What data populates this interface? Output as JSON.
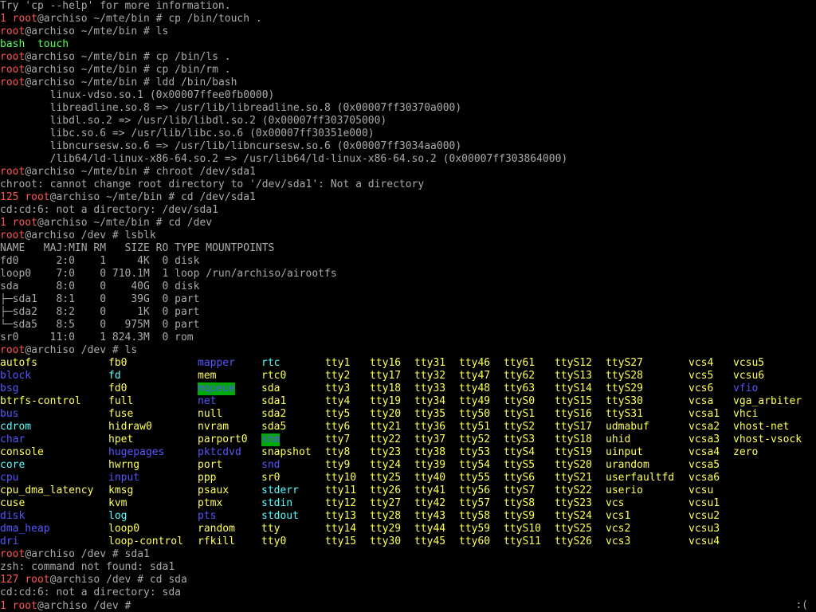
{
  "theme": {
    "background": "#000000",
    "default": "#aaaaaa",
    "red": "#ff5555",
    "green": "#55ff55",
    "yellow": "#ffff55",
    "blue": "#5555ff",
    "cyan": "#55ffff",
    "highlight_bg": "#00aa00"
  },
  "terminal": {
    "lines": [
      [
        {
          "t": "Try 'cp --help' for more information.",
          "c": "default"
        }
      ],
      [
        {
          "t": "1 ",
          "c": "red"
        },
        {
          "t": "root",
          "c": "red"
        },
        {
          "t": "@archiso ~/mte/bin # cp /bin/touch .",
          "c": "default"
        }
      ],
      [
        {
          "t": "root",
          "c": "red"
        },
        {
          "t": "@archiso ~/mte/bin # ls",
          "c": "default"
        }
      ],
      [
        {
          "t": "bash  touch",
          "c": "green"
        }
      ],
      [
        {
          "t": "root",
          "c": "red"
        },
        {
          "t": "@archiso ~/mte/bin # cp /bin/ls .",
          "c": "default"
        }
      ],
      [
        {
          "t": "root",
          "c": "red"
        },
        {
          "t": "@archiso ~/mte/bin # cp /bin/rm .",
          "c": "default"
        }
      ],
      [
        {
          "t": "root",
          "c": "red"
        },
        {
          "t": "@archiso ~/mte/bin # ldd /bin/bash",
          "c": "default"
        }
      ],
      [
        {
          "t": "        linux-vdso.so.1 (0x00007ffee0fb0000)",
          "c": "default"
        }
      ],
      [
        {
          "t": "        libreadline.so.8 => /usr/lib/libreadline.so.8 (0x00007ff30370a000)",
          "c": "default"
        }
      ],
      [
        {
          "t": "        libdl.so.2 => /usr/lib/libdl.so.2 (0x00007ff303705000)",
          "c": "default"
        }
      ],
      [
        {
          "t": "        libc.so.6 => /usr/lib/libc.so.6 (0x00007ff30351e000)",
          "c": "default"
        }
      ],
      [
        {
          "t": "        libncursesw.so.6 => /usr/lib/libncursesw.so.6 (0x00007ff3034aa000)",
          "c": "default"
        }
      ],
      [
        {
          "t": "        /lib64/ld-linux-x86-64.so.2 => /usr/lib64/ld-linux-x86-64.so.2 (0x00007ff303864000)",
          "c": "default"
        }
      ],
      [
        {
          "t": "root",
          "c": "red"
        },
        {
          "t": "@archiso ~/mte/bin # chroot /dev/sda1",
          "c": "default"
        }
      ],
      [
        {
          "t": "chroot: cannot change root directory to '/dev/sda1': Not a directory",
          "c": "default"
        }
      ],
      [
        {
          "t": "125 ",
          "c": "red"
        },
        {
          "t": "root",
          "c": "red"
        },
        {
          "t": "@archiso ~/mte/bin # cd /dev/sda1",
          "c": "default"
        }
      ],
      [
        {
          "t": "cd:cd:6: not a directory: /dev/sda1",
          "c": "default"
        }
      ],
      [
        {
          "t": "1 ",
          "c": "red"
        },
        {
          "t": "root",
          "c": "red"
        },
        {
          "t": "@archiso ~/mte/bin # cd /dev",
          "c": "default"
        }
      ],
      [
        {
          "t": "root",
          "c": "red"
        },
        {
          "t": "@archiso /dev # lsblk",
          "c": "default"
        }
      ],
      [
        {
          "t": "NAME   MAJ:MIN RM   SIZE RO TYPE MOUNTPOINTS",
          "c": "default"
        }
      ],
      [
        {
          "t": "fd0      2:0    1     4K  0 disk",
          "c": "default"
        }
      ],
      [
        {
          "t": "loop0    7:0    0 710.1M  1 loop /run/archiso/airootfs",
          "c": "default"
        }
      ],
      [
        {
          "t": "sda      8:0    0    40G  0 disk",
          "c": "default"
        }
      ],
      [
        {
          "t": "├─sda1   8:1    0    39G  0 part",
          "c": "default"
        }
      ],
      [
        {
          "t": "├─sda2   8:2    0     1K  0 part",
          "c": "default"
        }
      ],
      [
        {
          "t": "└─sda5   8:5    0   975M  0 part",
          "c": "default"
        }
      ],
      [
        {
          "t": "sr0     11:0    1 824.3M  0 rom",
          "c": "default"
        }
      ],
      [
        {
          "t": "root",
          "c": "red"
        },
        {
          "t": "@archiso /dev # ls",
          "c": "default"
        }
      ]
    ],
    "listing": {
      "columns": [
        0,
        136,
        248,
        328,
        408,
        464,
        520,
        576,
        632,
        696,
        760,
        864,
        920
      ],
      "rows": [
        [
          [
            "autofs",
            "yellow"
          ],
          [
            "fb0",
            "yellow"
          ],
          [
            "mapper",
            "blue"
          ],
          [
            "rtc",
            "cyan"
          ],
          [
            "tty1",
            "yellow"
          ],
          [
            "tty16",
            "yellow"
          ],
          [
            "tty31",
            "yellow"
          ],
          [
            "tty46",
            "yellow"
          ],
          [
            "tty61",
            "yellow"
          ],
          [
            "ttyS12",
            "yellow"
          ],
          [
            "ttyS27",
            "yellow"
          ],
          [
            "vcs4",
            "yellow"
          ],
          [
            "vcsu5",
            "yellow"
          ]
        ],
        [
          [
            "block",
            "blue"
          ],
          [
            "fd",
            "cyan"
          ],
          [
            "mem",
            "yellow"
          ],
          [
            "rtc0",
            "yellow"
          ],
          [
            "tty2",
            "yellow"
          ],
          [
            "tty17",
            "yellow"
          ],
          [
            "tty32",
            "yellow"
          ],
          [
            "tty47",
            "yellow"
          ],
          [
            "tty62",
            "yellow"
          ],
          [
            "ttyS13",
            "yellow"
          ],
          [
            "ttyS28",
            "yellow"
          ],
          [
            "vcs5",
            "yellow"
          ],
          [
            "vcsu6",
            "yellow"
          ]
        ],
        [
          [
            "bsg",
            "blue"
          ],
          [
            "fd0",
            "yellow"
          ],
          [
            "mqueue",
            "hl"
          ],
          [
            "sda",
            "yellow"
          ],
          [
            "tty3",
            "yellow"
          ],
          [
            "tty18",
            "yellow"
          ],
          [
            "tty33",
            "yellow"
          ],
          [
            "tty48",
            "yellow"
          ],
          [
            "tty63",
            "yellow"
          ],
          [
            "ttyS14",
            "yellow"
          ],
          [
            "ttyS29",
            "yellow"
          ],
          [
            "vcs6",
            "yellow"
          ],
          [
            "vfio",
            "blue"
          ]
        ],
        [
          [
            "btrfs-control",
            "yellow"
          ],
          [
            "full",
            "yellow"
          ],
          [
            "net",
            "blue"
          ],
          [
            "sda1",
            "yellow"
          ],
          [
            "tty4",
            "yellow"
          ],
          [
            "tty19",
            "yellow"
          ],
          [
            "tty34",
            "yellow"
          ],
          [
            "tty49",
            "yellow"
          ],
          [
            "ttyS0",
            "yellow"
          ],
          [
            "ttyS15",
            "yellow"
          ],
          [
            "ttyS30",
            "yellow"
          ],
          [
            "vcsa",
            "yellow"
          ],
          [
            "vga_arbiter",
            "yellow"
          ]
        ],
        [
          [
            "bus",
            "blue"
          ],
          [
            "fuse",
            "yellow"
          ],
          [
            "null",
            "yellow"
          ],
          [
            "sda2",
            "yellow"
          ],
          [
            "tty5",
            "yellow"
          ],
          [
            "tty20",
            "yellow"
          ],
          [
            "tty35",
            "yellow"
          ],
          [
            "tty50",
            "yellow"
          ],
          [
            "ttyS1",
            "yellow"
          ],
          [
            "ttyS16",
            "yellow"
          ],
          [
            "ttyS31",
            "yellow"
          ],
          [
            "vcsa1",
            "yellow"
          ],
          [
            "vhci",
            "yellow"
          ]
        ],
        [
          [
            "cdrom",
            "cyan"
          ],
          [
            "hidraw0",
            "yellow"
          ],
          [
            "nvram",
            "yellow"
          ],
          [
            "sda5",
            "yellow"
          ],
          [
            "tty6",
            "yellow"
          ],
          [
            "tty21",
            "yellow"
          ],
          [
            "tty36",
            "yellow"
          ],
          [
            "tty51",
            "yellow"
          ],
          [
            "ttyS2",
            "yellow"
          ],
          [
            "ttyS17",
            "yellow"
          ],
          [
            "udmabuf",
            "yellow"
          ],
          [
            "vcsa2",
            "yellow"
          ],
          [
            "vhost-net",
            "yellow"
          ]
        ],
        [
          [
            "char",
            "blue"
          ],
          [
            "hpet",
            "yellow"
          ],
          [
            "parport0",
            "yellow"
          ],
          [
            "shm",
            "hl"
          ],
          [
            "tty7",
            "yellow"
          ],
          [
            "tty22",
            "yellow"
          ],
          [
            "tty37",
            "yellow"
          ],
          [
            "tty52",
            "yellow"
          ],
          [
            "ttyS3",
            "yellow"
          ],
          [
            "ttyS18",
            "yellow"
          ],
          [
            "uhid",
            "yellow"
          ],
          [
            "vcsa3",
            "yellow"
          ],
          [
            "vhost-vsock",
            "yellow"
          ]
        ],
        [
          [
            "console",
            "yellow"
          ],
          [
            "hugepages",
            "blue"
          ],
          [
            "pktcdvd",
            "blue"
          ],
          [
            "snapshot",
            "yellow"
          ],
          [
            "tty8",
            "yellow"
          ],
          [
            "tty23",
            "yellow"
          ],
          [
            "tty38",
            "yellow"
          ],
          [
            "tty53",
            "yellow"
          ],
          [
            "ttyS4",
            "yellow"
          ],
          [
            "ttyS19",
            "yellow"
          ],
          [
            "uinput",
            "yellow"
          ],
          [
            "vcsa4",
            "yellow"
          ],
          [
            "zero",
            "yellow"
          ]
        ],
        [
          [
            "core",
            "cyan"
          ],
          [
            "hwrng",
            "yellow"
          ],
          [
            "port",
            "yellow"
          ],
          [
            "snd",
            "blue"
          ],
          [
            "tty9",
            "yellow"
          ],
          [
            "tty24",
            "yellow"
          ],
          [
            "tty39",
            "yellow"
          ],
          [
            "tty54",
            "yellow"
          ],
          [
            "ttyS5",
            "yellow"
          ],
          [
            "ttyS20",
            "yellow"
          ],
          [
            "urandom",
            "yellow"
          ],
          [
            "vcsa5",
            "yellow"
          ]
        ],
        [
          [
            "cpu",
            "blue"
          ],
          [
            "input",
            "blue"
          ],
          [
            "ppp",
            "yellow"
          ],
          [
            "sr0",
            "yellow"
          ],
          [
            "tty10",
            "yellow"
          ],
          [
            "tty25",
            "yellow"
          ],
          [
            "tty40",
            "yellow"
          ],
          [
            "tty55",
            "yellow"
          ],
          [
            "ttyS6",
            "yellow"
          ],
          [
            "ttyS21",
            "yellow"
          ],
          [
            "userfaultfd",
            "yellow"
          ],
          [
            "vcsa6",
            "yellow"
          ]
        ],
        [
          [
            "cpu_dma_latency",
            "yellow"
          ],
          [
            "kmsg",
            "yellow"
          ],
          [
            "psaux",
            "yellow"
          ],
          [
            "stderr",
            "cyan"
          ],
          [
            "tty11",
            "yellow"
          ],
          [
            "tty26",
            "yellow"
          ],
          [
            "tty41",
            "yellow"
          ],
          [
            "tty56",
            "yellow"
          ],
          [
            "ttyS7",
            "yellow"
          ],
          [
            "ttyS22",
            "yellow"
          ],
          [
            "userio",
            "yellow"
          ],
          [
            "vcsu",
            "yellow"
          ]
        ],
        [
          [
            "cuse",
            "yellow"
          ],
          [
            "kvm",
            "yellow"
          ],
          [
            "ptmx",
            "yellow"
          ],
          [
            "stdin",
            "cyan"
          ],
          [
            "tty12",
            "yellow"
          ],
          [
            "tty27",
            "yellow"
          ],
          [
            "tty42",
            "yellow"
          ],
          [
            "tty57",
            "yellow"
          ],
          [
            "ttyS8",
            "yellow"
          ],
          [
            "ttyS23",
            "yellow"
          ],
          [
            "vcs",
            "yellow"
          ],
          [
            "vcsu1",
            "yellow"
          ]
        ],
        [
          [
            "disk",
            "blue"
          ],
          [
            "log",
            "cyan"
          ],
          [
            "pts",
            "blue"
          ],
          [
            "stdout",
            "cyan"
          ],
          [
            "tty13",
            "yellow"
          ],
          [
            "tty28",
            "yellow"
          ],
          [
            "tty43",
            "yellow"
          ],
          [
            "tty58",
            "yellow"
          ],
          [
            "ttyS9",
            "yellow"
          ],
          [
            "ttyS24",
            "yellow"
          ],
          [
            "vcs1",
            "yellow"
          ],
          [
            "vcsu2",
            "yellow"
          ]
        ],
        [
          [
            "dma_heap",
            "blue"
          ],
          [
            "loop0",
            "yellow"
          ],
          [
            "random",
            "yellow"
          ],
          [
            "tty",
            "yellow"
          ],
          [
            "tty14",
            "yellow"
          ],
          [
            "tty29",
            "yellow"
          ],
          [
            "tty44",
            "yellow"
          ],
          [
            "tty59",
            "yellow"
          ],
          [
            "ttyS10",
            "yellow"
          ],
          [
            "ttyS25",
            "yellow"
          ],
          [
            "vcs2",
            "yellow"
          ],
          [
            "vcsu3",
            "yellow"
          ]
        ],
        [
          [
            "dri",
            "blue"
          ],
          [
            "loop-control",
            "yellow"
          ],
          [
            "rfkill",
            "yellow"
          ],
          [
            "tty0",
            "yellow"
          ],
          [
            "tty15",
            "yellow"
          ],
          [
            "tty30",
            "yellow"
          ],
          [
            "tty45",
            "yellow"
          ],
          [
            "tty60",
            "yellow"
          ],
          [
            "ttyS11",
            "yellow"
          ],
          [
            "ttyS26",
            "yellow"
          ],
          [
            "vcs3",
            "yellow"
          ],
          [
            "vcsu4",
            "yellow"
          ]
        ]
      ]
    },
    "after": [
      [
        {
          "t": "root",
          "c": "red"
        },
        {
          "t": "@archiso /dev # sda1",
          "c": "default"
        }
      ],
      [
        {
          "t": "zsh: command not found: sda1",
          "c": "default"
        }
      ],
      [
        {
          "t": "127 ",
          "c": "red"
        },
        {
          "t": "root",
          "c": "red"
        },
        {
          "t": "@archiso /dev # cd sda",
          "c": "default"
        }
      ],
      [
        {
          "t": "cd:cd:6: not a directory: sda",
          "c": "default"
        }
      ],
      [
        {
          "t": "1 ",
          "c": "red"
        },
        {
          "t": "root",
          "c": "red"
        },
        {
          "t": "@archiso /dev # ",
          "c": "default"
        }
      ]
    ],
    "status_right": ":("
  }
}
